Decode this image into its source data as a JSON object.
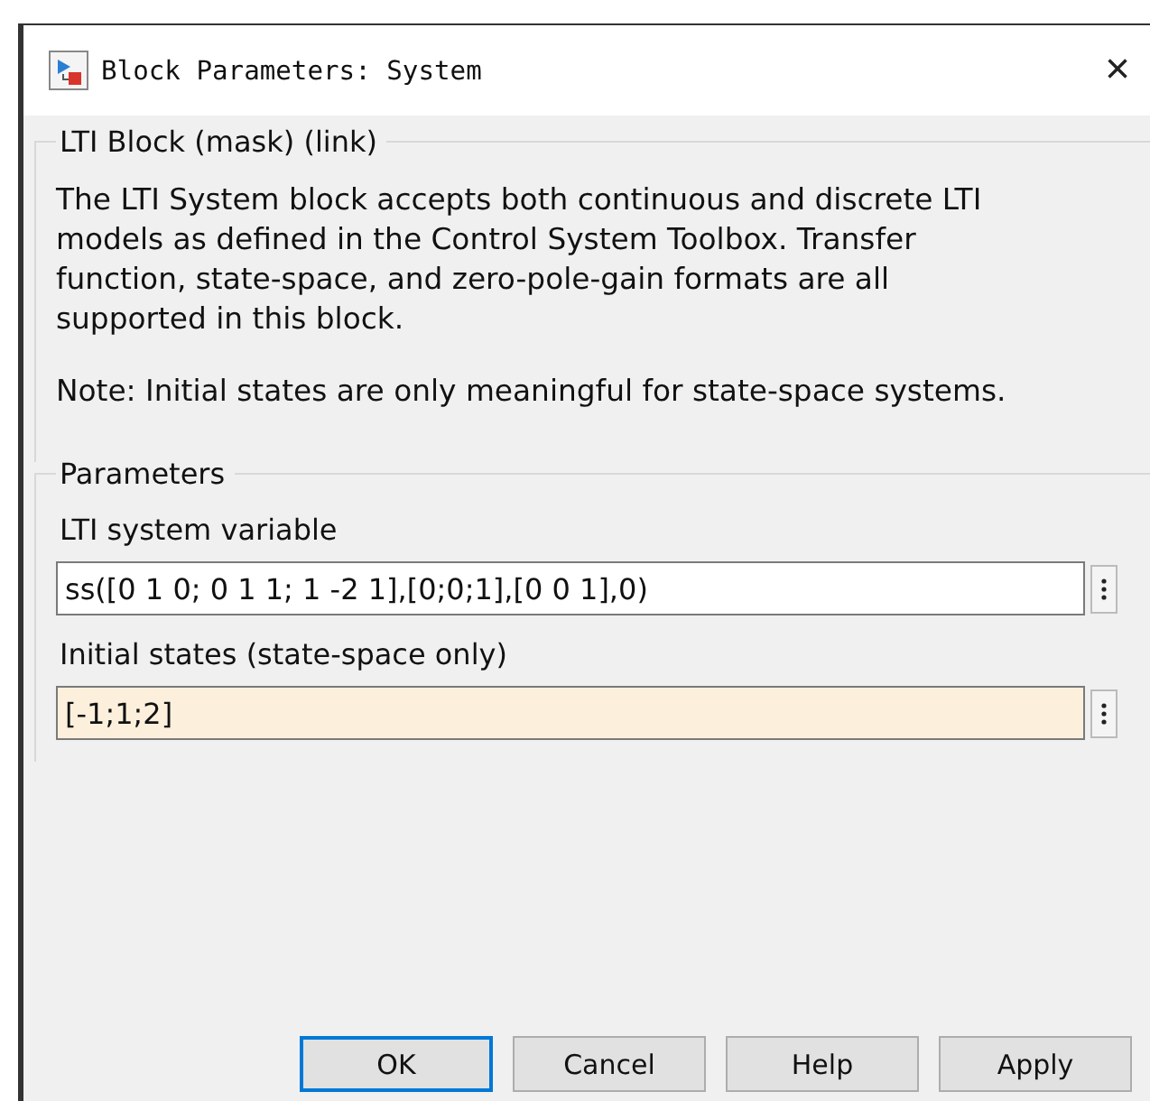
{
  "window": {
    "title": "Block Parameters: System",
    "close": "×"
  },
  "description_group": {
    "title": "LTI Block (mask) (link)",
    "paragraphs": [
      "The LTI System block accepts both continuous and discrete LTI models as defined in the Control System Toolbox. Transfer function, state-space, and zero-pole-gain formats are all supported in this block.",
      "Note: Initial states are only meaningful for state-space systems."
    ]
  },
  "parameters_group": {
    "title": "Parameters",
    "fields": [
      {
        "label": "LTI system variable",
        "value": "ss([0 1 0; 0 1 1; 1 -2 1],[0;0;1],[0 0 1],0)",
        "modified": false
      },
      {
        "label": "Initial states (state-space only)",
        "value": "[-1;1;2]",
        "modified": true
      }
    ]
  },
  "buttons": [
    {
      "label": "OK",
      "focused": true
    },
    {
      "label": "Cancel",
      "focused": false
    },
    {
      "label": "Help",
      "focused": false
    },
    {
      "label": "Apply",
      "focused": false
    }
  ]
}
